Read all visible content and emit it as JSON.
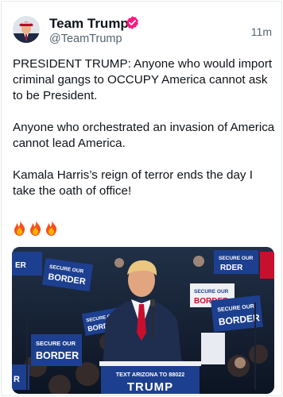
{
  "post": {
    "author_name": "Team Trump",
    "handle": "@TeamTrump",
    "timestamp": "11m",
    "paragraphs": [
      "PRESIDENT TRUMP: Anyone who would import criminal gangs to OCCUPY America cannot ask to be President.",
      "Anyone who orchestrated an invasion of America cannot lead America.",
      "Kamala Harris’s reign of terror ends the day I take the oath of office!"
    ],
    "emoji_count": 3,
    "emoji_icon": "fire-icon"
  },
  "media": {
    "signs": {
      "secure_our": "SECURE OUR",
      "border": "BORDER",
      "border_partial": "RDER",
      "er": "ER",
      "r": "R"
    },
    "podium_text": "TEXT ARIZONA TO 88022",
    "podium_title": "TRUMP"
  },
  "colors": {
    "verified": "#f91880",
    "handle": "#536471",
    "sign_blue": "#1d3f8f",
    "sign_red": "#c8102e"
  }
}
